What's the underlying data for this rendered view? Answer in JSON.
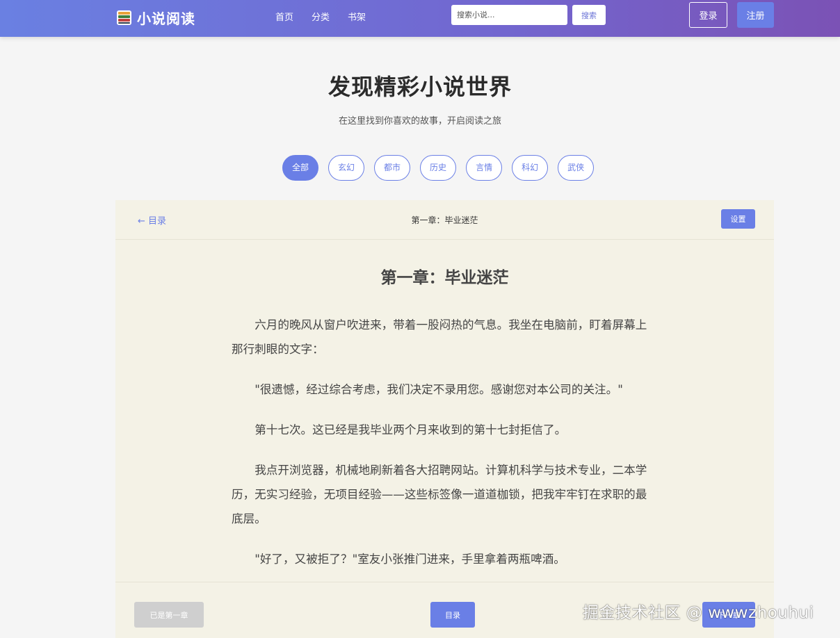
{
  "header": {
    "logo_text": "小说阅读",
    "nav": [
      "首页",
      "分类",
      "书架"
    ],
    "search_placeholder": "搜索小说...",
    "search_button": "搜索",
    "login_button": "登录",
    "register_button": "注册"
  },
  "hero": {
    "title": "发现精彩小说世界",
    "subtitle": "在这里找到你喜欢的故事，开启阅读之旅"
  },
  "categories": [
    "全部",
    "玄幻",
    "都市",
    "历史",
    "言情",
    "科幻",
    "武侠"
  ],
  "active_category": "全部",
  "reader": {
    "back_link": "← 目录",
    "top_chapter_title": "第一章：毕业迷茫",
    "settings_button": "设置",
    "chapter_title": "第一章：毕业迷茫",
    "paragraphs": [
      "六月的晚风从窗户吹进来，带着一股闷热的气息。我坐在电脑前，盯着屏幕上那行刺眼的文字：",
      "\"很遗憾，经过综合考虑，我们决定不录用您。感谢您对本公司的关注。\"",
      "第十七次。这已经是我毕业两个月来收到的第十七封拒信了。",
      "我点开浏览器，机械地刷新着各大招聘网站。计算机科学与技术专业，二本学历，无实习经验，无项目经验——这些标签像一道道枷锁，把我牢牢钉在求职的最底层。",
      "\"好了，又被拒了？\"室友小张推门进来，手里拿着两瓶啤酒。"
    ],
    "prev_button": "已是第一章",
    "toc_button": "目录",
    "next_button": "下一章"
  },
  "watermark": "掘金技术社区 @ wwwzhouhui",
  "colors": {
    "accent": "#6a7fe6",
    "header_gradient_start": "#6a80e2",
    "header_gradient_end": "#7b52b5",
    "reader_bg": "#f4f2e6"
  }
}
